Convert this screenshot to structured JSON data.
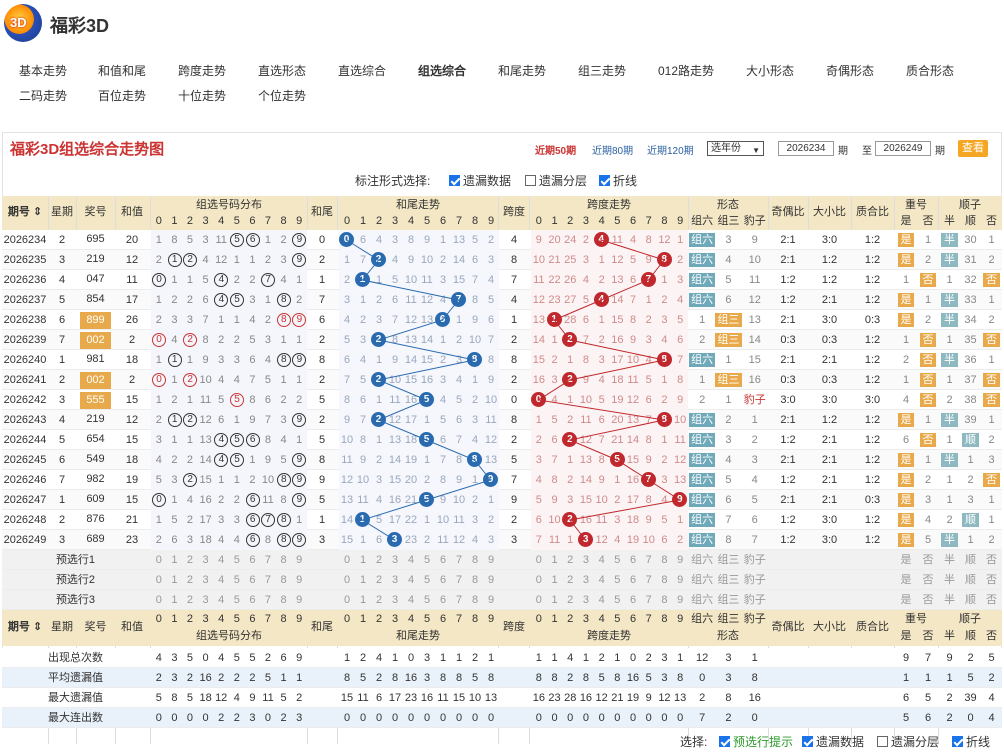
{
  "site": {
    "logo_text": "3D",
    "title": "福彩3D"
  },
  "nav": [
    [
      "基本走势",
      19,
      62,
      false
    ],
    [
      "和值和尾",
      98,
      62,
      false
    ],
    [
      "跨度走势",
      178,
      62,
      false
    ],
    [
      "直选形态",
      258,
      62,
      false
    ],
    [
      "直选综合",
      338,
      62,
      false
    ],
    [
      "组选综合",
      418,
      62,
      true
    ],
    [
      "和尾走势",
      498,
      62,
      false
    ],
    [
      "组三走势",
      578,
      62,
      false
    ],
    [
      "012路走势",
      658,
      62,
      false
    ],
    [
      "大小形态",
      746,
      62,
      false
    ],
    [
      "奇偶形态",
      826,
      62,
      false
    ],
    [
      "质合形态",
      906,
      62,
      false
    ],
    [
      "二码走势",
      19,
      87,
      false
    ],
    [
      "百位走势",
      98,
      87,
      false
    ],
    [
      "十位走势",
      178,
      87,
      false
    ],
    [
      "个位走势",
      258,
      87,
      false
    ]
  ],
  "chart_title": "福彩3D组选综合走势图",
  "range_links": [
    "近期50期",
    "近期80期",
    "近期120期"
  ],
  "year_select": "选年份",
  "period_from": "2026234",
  "period_to": "2026249",
  "period_label": "期",
  "to_label": "至",
  "view_button": "查看",
  "mark_label": "标注形式选择:",
  "options": [
    {
      "label": "遗漏数据",
      "checked": true
    },
    {
      "label": "遗漏分层",
      "checked": false
    },
    {
      "label": "折线",
      "checked": true
    }
  ],
  "headers": {
    "issue": "期号",
    "week": "星期",
    "prize": "奖号",
    "sum": "和值",
    "dist": "组选号码分布",
    "tail": "和尾",
    "tailtrend": "和尾走势",
    "span": "跨度",
    "spantrend": "跨度走势",
    "shape": "形态",
    "oe": "奇偶比",
    "bs": "大小比",
    "pc": "质合比",
    "rep": "重号",
    "seq": "顺子",
    "shape_sub": [
      "组六",
      "组三",
      "豹子"
    ],
    "rep_sub": [
      "是",
      "否"
    ],
    "seq_sub": [
      "半",
      "顺",
      "否"
    ]
  },
  "rows": [
    {
      "issue": "2026234",
      "week": "2",
      "prize": "695",
      "sum": "20",
      "tail": "0",
      "span": "4",
      "shape": "组六",
      "oe": "2:1",
      "bs": "3:0",
      "pc": "1:2",
      "rep": "是",
      "seq": "半",
      "dist": [
        "1",
        "8",
        "5",
        "3",
        "11",
        "5",
        "6",
        "1",
        "2",
        "9"
      ],
      "tt": [
        "0",
        "6",
        "4",
        "3",
        "8",
        "9",
        "1",
        "13",
        "5",
        "2"
      ],
      "st": [
        "9",
        "20",
        "24",
        "2",
        "4",
        "11",
        "4",
        "8",
        "12",
        "1"
      ],
      "sh": [
        "组六",
        "3",
        "9"
      ],
      "rp": [
        "是",
        "1"
      ],
      "sq": [
        "半",
        "30",
        "1"
      ]
    },
    {
      "issue": "2026235",
      "week": "3",
      "prize": "219",
      "sum": "12",
      "tail": "2",
      "span": "8",
      "shape": "组六",
      "oe": "2:1",
      "bs": "1:2",
      "pc": "1:2",
      "rep": "是",
      "seq": "半",
      "dist": [
        "2",
        "1",
        "2",
        "4",
        "12",
        "1",
        "1",
        "2",
        "3",
        "9"
      ],
      "tt": [
        "1",
        "7",
        "2",
        "4",
        "9",
        "10",
        "2",
        "14",
        "6",
        "3"
      ],
      "st": [
        "10",
        "21",
        "25",
        "3",
        "1",
        "12",
        "5",
        "9",
        "8",
        "2"
      ],
      "sh": [
        "组六",
        "4",
        "10"
      ],
      "rp": [
        "是",
        "2"
      ],
      "sq": [
        "半",
        "31",
        "2"
      ]
    },
    {
      "issue": "2026236",
      "week": "4",
      "prize": "047",
      "sum": "11",
      "tail": "1",
      "span": "7",
      "shape": "组六",
      "oe": "1:2",
      "bs": "1:2",
      "pc": "1:2",
      "rep": "1",
      "seq": "否",
      "dist": [
        "0",
        "1",
        "1",
        "5",
        "4",
        "2",
        "2",
        "7",
        "4",
        "1"
      ],
      "tt": [
        "2",
        "1",
        "1",
        "5",
        "10",
        "11",
        "3",
        "15",
        "7",
        "4"
      ],
      "st": [
        "11",
        "22",
        "26",
        "4",
        "2",
        "13",
        "6",
        "7",
        "1",
        "3"
      ],
      "sh": [
        "组六",
        "5",
        "11"
      ],
      "rp": [
        "1",
        "否"
      ],
      "sq": [
        "1",
        "32",
        "否"
      ]
    },
    {
      "issue": "2026237",
      "week": "5",
      "prize": "854",
      "sum": "17",
      "tail": "7",
      "span": "4",
      "shape": "组六",
      "oe": "1:2",
      "bs": "2:1",
      "pc": "1:2",
      "rep": "是",
      "seq": "半",
      "dist": [
        "1",
        "2",
        "2",
        "6",
        "4",
        "5",
        "3",
        "1",
        "8",
        "2"
      ],
      "tt": [
        "3",
        "1",
        "2",
        "6",
        "11",
        "12",
        "4",
        "7",
        "8",
        "5"
      ],
      "st": [
        "12",
        "23",
        "27",
        "5",
        "4",
        "14",
        "7",
        "1",
        "2",
        "4"
      ],
      "sh": [
        "组六",
        "6",
        "12"
      ],
      "rp": [
        "是",
        "1"
      ],
      "sq": [
        "半",
        "33",
        "1"
      ]
    },
    {
      "issue": "2026238",
      "week": "6",
      "prize": "899",
      "sum": "26",
      "tail": "6",
      "span": "1",
      "shape": "组三",
      "oe": "2:1",
      "bs": "3:0",
      "pc": "0:3",
      "rep": "是",
      "seq": "否",
      "dist": [
        "2",
        "3",
        "3",
        "7",
        "1",
        "1",
        "4",
        "2",
        "8",
        "9"
      ],
      "tt": [
        "4",
        "2",
        "3",
        "7",
        "12",
        "13",
        "6",
        "1",
        "9",
        "6"
      ],
      "st": [
        "13",
        "1",
        "28",
        "6",
        "1",
        "15",
        "8",
        "2",
        "3",
        "5"
      ],
      "sh": [
        "1",
        "组三",
        "13"
      ],
      "rp": [
        "是",
        "2"
      ],
      "sq": [
        "半",
        "34",
        "2"
      ]
    },
    {
      "issue": "2026239",
      "week": "7",
      "prize": "002",
      "sum": "2",
      "tail": "2",
      "span": "2",
      "shape": "组三",
      "oe": "0:3",
      "bs": "0:3",
      "pc": "1:2",
      "rep": "1",
      "seq": "否",
      "dist": [
        "0",
        "4",
        "2",
        "8",
        "2",
        "2",
        "5",
        "3",
        "1",
        "1"
      ],
      "tt": [
        "5",
        "3",
        "2",
        "8",
        "13",
        "14",
        "1",
        "2",
        "10",
        "7"
      ],
      "st": [
        "14",
        "1",
        "2",
        "7",
        "2",
        "16",
        "9",
        "3",
        "4",
        "6"
      ],
      "sh": [
        "2",
        "组三",
        "14"
      ],
      "rp": [
        "1",
        "否"
      ],
      "sq": [
        "1",
        "35",
        "否"
      ]
    },
    {
      "issue": "2026240",
      "week": "1",
      "prize": "981",
      "sum": "18",
      "tail": "8",
      "span": "8",
      "shape": "组六",
      "oe": "2:1",
      "bs": "2:1",
      "pc": "1:2",
      "rep": "2",
      "seq": "半",
      "dist": [
        "1",
        "1",
        "1",
        "9",
        "3",
        "3",
        "6",
        "4",
        "8",
        "9"
      ],
      "tt": [
        "6",
        "4",
        "1",
        "9",
        "14",
        "15",
        "2",
        "3",
        "8",
        "8"
      ],
      "st": [
        "15",
        "2",
        "1",
        "8",
        "3",
        "17",
        "10",
        "4",
        "8",
        "7"
      ],
      "sh": [
        "组六",
        "1",
        "15"
      ],
      "rp": [
        "2",
        "否"
      ],
      "sq": [
        "半",
        "36",
        "1"
      ]
    },
    {
      "issue": "2026241",
      "week": "2",
      "prize": "002",
      "sum": "2",
      "tail": "2",
      "span": "2",
      "shape": "组三",
      "oe": "0:3",
      "bs": "0:3",
      "pc": "1:2",
      "rep": "3",
      "seq": "否",
      "dist": [
        "0",
        "1",
        "2",
        "10",
        "4",
        "4",
        "7",
        "5",
        "1",
        "1"
      ],
      "tt": [
        "7",
        "5",
        "2",
        "10",
        "15",
        "16",
        "3",
        "4",
        "1",
        "9"
      ],
      "st": [
        "16",
        "3",
        "2",
        "9",
        "4",
        "18",
        "11",
        "5",
        "1",
        "8"
      ],
      "sh": [
        "1",
        "组三",
        "16"
      ],
      "rp": [
        "1",
        "否"
      ],
      "sq": [
        "1",
        "37",
        "否"
      ]
    },
    {
      "issue": "2026242",
      "week": "3",
      "prize": "555",
      "sum": "15",
      "tail": "5",
      "span": "0",
      "shape": "豹子",
      "oe": "3:0",
      "bs": "3:0",
      "pc": "3:0",
      "rep": "4",
      "seq": "否",
      "dist": [
        "1",
        "2",
        "1",
        "11",
        "5",
        "5",
        "8",
        "6",
        "2",
        "2"
      ],
      "tt": [
        "8",
        "6",
        "1",
        "11",
        "16",
        "5",
        "4",
        "5",
        "2",
        "10"
      ],
      "st": [
        "0",
        "4",
        "1",
        "10",
        "5",
        "19",
        "12",
        "6",
        "2",
        "9"
      ],
      "sh": [
        "2",
        "1",
        "豹子"
      ],
      "rp": [
        "4",
        "否"
      ],
      "sq": [
        "2",
        "38",
        "否"
      ]
    },
    {
      "issue": "2026243",
      "week": "4",
      "prize": "219",
      "sum": "12",
      "tail": "2",
      "span": "8",
      "shape": "组六",
      "oe": "2:1",
      "bs": "1:2",
      "pc": "1:2",
      "rep": "是",
      "seq": "半",
      "dist": [
        "2",
        "1",
        "2",
        "12",
        "6",
        "1",
        "9",
        "7",
        "3",
        "9"
      ],
      "tt": [
        "9",
        "7",
        "2",
        "12",
        "17",
        "1",
        "5",
        "6",
        "3",
        "11"
      ],
      "st": [
        "1",
        "5",
        "2",
        "11",
        "6",
        "20",
        "13",
        "7",
        "8",
        "10"
      ],
      "sh": [
        "组六",
        "2",
        "1"
      ],
      "rp": [
        "是",
        "1"
      ],
      "sq": [
        "半",
        "39",
        "1"
      ]
    },
    {
      "issue": "2026244",
      "week": "5",
      "prize": "654",
      "sum": "15",
      "tail": "5",
      "span": "2",
      "shape": "组六",
      "oe": "1:2",
      "bs": "2:1",
      "pc": "1:2",
      "rep": "6",
      "seq": "顺",
      "dist": [
        "3",
        "1",
        "1",
        "13",
        "4",
        "5",
        "6",
        "8",
        "4",
        "1"
      ],
      "tt": [
        "10",
        "8",
        "1",
        "13",
        "18",
        "5",
        "6",
        "7",
        "4",
        "12"
      ],
      "st": [
        "2",
        "6",
        "2",
        "12",
        "7",
        "21",
        "14",
        "8",
        "1",
        "11"
      ],
      "sh": [
        "组六",
        "3",
        "2"
      ],
      "rp": [
        "6",
        "否"
      ],
      "sq": [
        "1",
        "顺",
        "2"
      ]
    },
    {
      "issue": "2026245",
      "week": "6",
      "prize": "549",
      "sum": "18",
      "tail": "8",
      "span": "5",
      "shape": "组六",
      "oe": "2:1",
      "bs": "2:1",
      "pc": "1:2",
      "rep": "是",
      "seq": "半",
      "dist": [
        "4",
        "2",
        "2",
        "14",
        "4",
        "5",
        "1",
        "9",
        "5",
        "9"
      ],
      "tt": [
        "11",
        "9",
        "2",
        "14",
        "19",
        "1",
        "7",
        "8",
        "8",
        "13"
      ],
      "st": [
        "3",
        "7",
        "1",
        "13",
        "8",
        "5",
        "15",
        "9",
        "2",
        "12"
      ],
      "sh": [
        "组六",
        "4",
        "3"
      ],
      "rp": [
        "是",
        "1"
      ],
      "sq": [
        "半",
        "1",
        "3"
      ]
    },
    {
      "issue": "2026246",
      "week": "7",
      "prize": "982",
      "sum": "19",
      "tail": "9",
      "span": "7",
      "shape": "组六",
      "oe": "1:2",
      "bs": "2:1",
      "pc": "1:2",
      "rep": "是",
      "seq": "否",
      "dist": [
        "5",
        "3",
        "2",
        "15",
        "1",
        "1",
        "2",
        "10",
        "8",
        "9"
      ],
      "tt": [
        "12",
        "10",
        "3",
        "15",
        "20",
        "2",
        "8",
        "9",
        "1",
        "9"
      ],
      "st": [
        "4",
        "8",
        "2",
        "14",
        "9",
        "1",
        "16",
        "7",
        "3",
        "13"
      ],
      "sh": [
        "组六",
        "5",
        "4"
      ],
      "rp": [
        "是",
        "2"
      ],
      "sq": [
        "1",
        "2",
        "否"
      ]
    },
    {
      "issue": "2026247",
      "week": "1",
      "prize": "609",
      "sum": "15",
      "tail": "5",
      "span": "9",
      "shape": "组六",
      "oe": "2:1",
      "bs": "2:1",
      "pc": "0:3",
      "rep": "是",
      "seq": "否",
      "dist": [
        "0",
        "1",
        "4",
        "16",
        "2",
        "2",
        "6",
        "11",
        "8",
        "9"
      ],
      "tt": [
        "13",
        "11",
        "4",
        "16",
        "21",
        "5",
        "9",
        "10",
        "2",
        "1"
      ],
      "st": [
        "5",
        "9",
        "3",
        "15",
        "10",
        "2",
        "17",
        "8",
        "4",
        "9"
      ],
      "sh": [
        "组六",
        "6",
        "5"
      ],
      "rp": [
        "是",
        "3"
      ],
      "sq": [
        "1",
        "3",
        "1"
      ]
    },
    {
      "issue": "2026248",
      "week": "2",
      "prize": "876",
      "sum": "21",
      "tail": "1",
      "span": "2",
      "shape": "组六",
      "oe": "1:2",
      "bs": "3:0",
      "pc": "1:2",
      "rep": "是",
      "seq": "顺",
      "dist": [
        "1",
        "5",
        "2",
        "17",
        "3",
        "3",
        "6",
        "7",
        "8",
        "1"
      ],
      "tt": [
        "14",
        "1",
        "5",
        "17",
        "22",
        "1",
        "10",
        "11",
        "3",
        "2"
      ],
      "st": [
        "6",
        "10",
        "2",
        "16",
        "11",
        "3",
        "18",
        "9",
        "5",
        "1"
      ],
      "sh": [
        "组六",
        "7",
        "6"
      ],
      "rp": [
        "是",
        "4"
      ],
      "sq": [
        "2",
        "顺",
        "1"
      ]
    },
    {
      "issue": "2026249",
      "week": "3",
      "prize": "689",
      "sum": "23",
      "tail": "3",
      "span": "3",
      "shape": "组六",
      "oe": "1:2",
      "bs": "3:0",
      "pc": "1:2",
      "rep": "是",
      "seq": "半",
      "dist": [
        "2",
        "6",
        "3",
        "18",
        "4",
        "4",
        "6",
        "8",
        "8",
        "9"
      ],
      "tt": [
        "15",
        "1",
        "6",
        "3",
        "23",
        "2",
        "11",
        "12",
        "4",
        "3"
      ],
      "st": [
        "7",
        "11",
        "1",
        "3",
        "12",
        "4",
        "19",
        "10",
        "6",
        "2"
      ],
      "sh": [
        "组六",
        "8",
        "7"
      ],
      "rp": [
        "是",
        "5"
      ],
      "sq": [
        "半",
        "1",
        "2"
      ]
    }
  ],
  "preselect": [
    "预选行1",
    "预选行2",
    "预选行3"
  ],
  "pre_labels": {
    "shape": [
      "组六",
      "组三",
      "豹子"
    ],
    "rep": [
      "是",
      "否"
    ],
    "seq": [
      "半",
      "顺",
      "否"
    ]
  },
  "stats": [
    {
      "label": "出现总次数",
      "dist": [
        "4",
        "3",
        "5",
        "0",
        "4",
        "5",
        "5",
        "2",
        "6",
        "9"
      ],
      "tt": [
        "1",
        "2",
        "4",
        "1",
        "0",
        "3",
        "1",
        "1",
        "2",
        "1"
      ],
      "st": [
        "1",
        "1",
        "4",
        "1",
        "2",
        "1",
        "0",
        "2",
        "3",
        "1"
      ],
      "sh": [
        "12",
        "3",
        "1"
      ],
      "rp": [
        "9",
        "7"
      ],
      "sq": [
        "9",
        "2",
        "5"
      ]
    },
    {
      "label": "平均遗漏值",
      "dist": [
        "2",
        "3",
        "2",
        "16",
        "2",
        "2",
        "2",
        "5",
        "1",
        "1"
      ],
      "tt": [
        "8",
        "5",
        "2",
        "8",
        "16",
        "3",
        "8",
        "8",
        "5",
        "8"
      ],
      "st": [
        "8",
        "8",
        "2",
        "8",
        "5",
        "8",
        "16",
        "5",
        "3",
        "8"
      ],
      "sh": [
        "0",
        "3",
        "8"
      ],
      "rp": [
        "1",
        "1"
      ],
      "sq": [
        "1",
        "5",
        "2"
      ]
    },
    {
      "label": "最大遗漏值",
      "dist": [
        "5",
        "8",
        "5",
        "18",
        "12",
        "4",
        "9",
        "11",
        "5",
        "2"
      ],
      "tt": [
        "15",
        "11",
        "6",
        "17",
        "23",
        "16",
        "11",
        "15",
        "10",
        "13"
      ],
      "st": [
        "16",
        "23",
        "28",
        "16",
        "12",
        "21",
        "19",
        "9",
        "12",
        "13"
      ],
      "sh": [
        "2",
        "8",
        "16"
      ],
      "rp": [
        "6",
        "5"
      ],
      "sq": [
        "2",
        "39",
        "4"
      ]
    },
    {
      "label": "最大连出数",
      "dist": [
        "0",
        "0",
        "0",
        "0",
        "2",
        "2",
        "3",
        "0",
        "2",
        "3"
      ],
      "tt": [
        "0",
        "0",
        "0",
        "0",
        "0",
        "0",
        "0",
        "0",
        "0",
        "0"
      ],
      "st": [
        "0",
        "0",
        "0",
        "0",
        "0",
        "0",
        "0",
        "0",
        "0",
        "0"
      ],
      "sh": [
        "7",
        "2",
        "0"
      ],
      "rp": [
        "5",
        "6"
      ],
      "sq": [
        "2",
        "0",
        "4"
      ]
    }
  ],
  "bottom": {
    "label": "选择:",
    "options": [
      {
        "label": "预选行提示",
        "checked": true,
        "green": true
      },
      {
        "label": "遗漏数据",
        "checked": true
      },
      {
        "label": "遗漏分层",
        "checked": false
      },
      {
        "label": "折线",
        "checked": true
      }
    ]
  },
  "colors": {
    "accent": "#c33",
    "tail_ball": "#2a6bb0",
    "span_ball": "#c0282d",
    "shape_tag": "#6fa8b8",
    "rep_tag": "#e8a94a",
    "seq_tag": "#8fb9c0",
    "header_bg": "#f4e7c5"
  }
}
